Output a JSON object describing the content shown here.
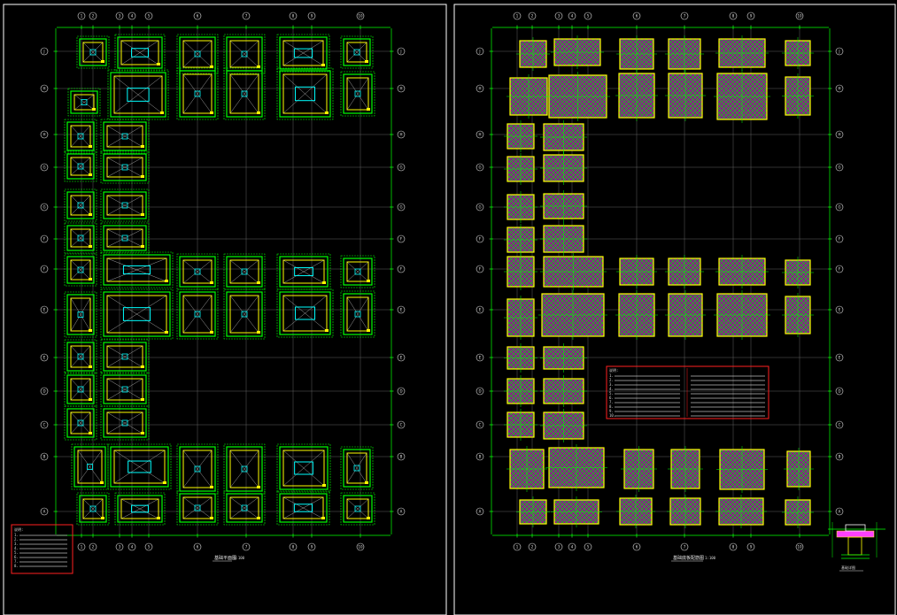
{
  "sheets": [
    {
      "id": "left",
      "title": "基础平面图",
      "scale": "1:100",
      "columns": [
        "1",
        "2",
        "3",
        "4",
        "5",
        "6",
        "7",
        "8",
        "9",
        "10"
      ],
      "rows": [
        "J",
        "H",
        "G",
        "F",
        "E",
        "D",
        "C",
        "B",
        "A"
      ],
      "notes_title": "说明:",
      "note_lines": [
        "1.",
        "2.",
        "3.",
        "4.",
        "5.",
        "6.",
        "7.",
        "8."
      ]
    },
    {
      "id": "right",
      "title": "基础底板配筋图",
      "scale": "1:100",
      "columns": [
        "1",
        "2",
        "3",
        "4",
        "5",
        "6",
        "7",
        "8",
        "9",
        "10"
      ],
      "rows": [
        "J",
        "H",
        "G",
        "F",
        "E",
        "D",
        "C",
        "B",
        "A"
      ],
      "notes_title": "说明:",
      "note_lines": [
        "1.",
        "2.",
        "3.",
        "4.",
        "5.",
        "6.",
        "7.",
        "8.",
        "9.",
        "10."
      ]
    }
  ],
  "detail": {
    "title": "基础详图"
  },
  "colors": {
    "background": "#000000",
    "frame": "#ffffff",
    "foundation_outline": "#00ff00",
    "pedestal": "#ffff00",
    "grid": "#7a7a7a",
    "rebar_fill": "#8a1f8a",
    "rebar_mesh": "#00e000",
    "notes_border": "#ff2020",
    "beam": "#00ffff"
  }
}
